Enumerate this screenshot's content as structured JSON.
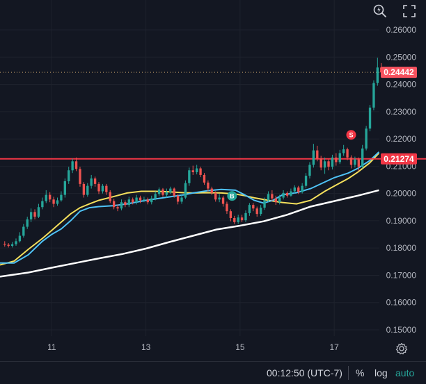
{
  "toolbar": {
    "magnify_icon": "magnify-lightning-icon",
    "fullscreen_icon": "fullscreen-icon"
  },
  "bottom_bar": {
    "time": "00:12:50 (UTC-7)",
    "percent": "%",
    "log": "log",
    "auto": "auto"
  },
  "colors": {
    "background": "#131722",
    "up_candle": "#26a69a",
    "down_candle": "#ef5350",
    "resistance": "#f23645",
    "ma_fast": "#4fc3f7",
    "ma_mid": "#f5e05c",
    "ma_slow": "#ffffff",
    "current_price": "#f7525f"
  },
  "chart_data": {
    "type": "candlestick",
    "y_axis": {
      "ticks": [
        "0.26000",
        "0.25000",
        "0.24000",
        "0.23000",
        "0.22000",
        "0.21000",
        "0.20000",
        "0.19000",
        "0.18000",
        "0.17000",
        "0.16000",
        "0.15000"
      ],
      "range": [
        0.1465,
        0.2635
      ]
    },
    "x_axis": {
      "ticks": [
        {
          "day": 11,
          "label": "11"
        },
        {
          "day": 13,
          "label": "13"
        },
        {
          "day": 15,
          "label": "15"
        },
        {
          "day": 17,
          "label": "17"
        }
      ],
      "range": [
        9.9,
        18.95
      ]
    },
    "resistance_level": {
      "value": 0.2127,
      "label": "0.21274"
    },
    "current_price": {
      "value": 0.24442,
      "label": "0.24442"
    },
    "markers": [
      {
        "label": "B",
        "day": 14.83,
        "price": 0.1991,
        "color": "#26a69a"
      },
      {
        "label": "S",
        "day": 17.36,
        "price": 0.2215,
        "color": "#f23645"
      }
    ],
    "ma_fast": [
      [
        9.9,
        0.1745
      ],
      [
        10.2,
        0.1745
      ],
      [
        10.5,
        0.1775
      ],
      [
        10.8,
        0.1825
      ],
      [
        11.0,
        0.185
      ],
      [
        11.2,
        0.187
      ],
      [
        11.4,
        0.19
      ],
      [
        11.6,
        0.1935
      ],
      [
        11.8,
        0.1948
      ],
      [
        12.0,
        0.1952
      ],
      [
        12.3,
        0.1955
      ],
      [
        12.6,
        0.1962
      ],
      [
        13.0,
        0.1975
      ],
      [
        13.4,
        0.1985
      ],
      [
        13.8,
        0.1995
      ],
      [
        14.0,
        0.2002
      ],
      [
        14.3,
        0.201
      ],
      [
        14.6,
        0.2015
      ],
      [
        14.9,
        0.2012
      ],
      [
        15.1,
        0.1995
      ],
      [
        15.3,
        0.1975
      ],
      [
        15.5,
        0.1965
      ],
      [
        15.7,
        0.1975
      ],
      [
        15.9,
        0.1995
      ],
      [
        16.2,
        0.2003
      ],
      [
        16.5,
        0.2018
      ],
      [
        16.8,
        0.2042
      ],
      [
        17.0,
        0.2058
      ],
      [
        17.3,
        0.2075
      ],
      [
        17.5,
        0.2092
      ],
      [
        17.75,
        0.212
      ],
      [
        17.95,
        0.2152
      ]
    ],
    "ma_mid": [
      [
        9.9,
        0.1738
      ],
      [
        10.2,
        0.1752
      ],
      [
        10.5,
        0.1795
      ],
      [
        10.8,
        0.1835
      ],
      [
        11.0,
        0.1865
      ],
      [
        11.2,
        0.1895
      ],
      [
        11.4,
        0.1925
      ],
      [
        11.6,
        0.1948
      ],
      [
        11.8,
        0.1962
      ],
      [
        12.0,
        0.1975
      ],
      [
        12.3,
        0.1988
      ],
      [
        12.6,
        0.2002
      ],
      [
        12.9,
        0.2008
      ],
      [
        13.2,
        0.2008
      ],
      [
        13.5,
        0.2006
      ],
      [
        13.8,
        0.2003
      ],
      [
        14.0,
        0.2002
      ],
      [
        14.3,
        0.2003
      ],
      [
        14.6,
        0.2002
      ],
      [
        14.9,
        0.1998
      ],
      [
        15.1,
        0.1992
      ],
      [
        15.3,
        0.1984
      ],
      [
        15.6,
        0.1975
      ],
      [
        15.9,
        0.1967
      ],
      [
        16.2,
        0.1962
      ],
      [
        16.5,
        0.1975
      ],
      [
        16.8,
        0.2008
      ],
      [
        17.0,
        0.2027
      ],
      [
        17.3,
        0.2055
      ],
      [
        17.5,
        0.2078
      ],
      [
        17.75,
        0.2112
      ],
      [
        17.95,
        0.2148
      ]
    ],
    "ma_slow": [
      [
        9.9,
        0.1695
      ],
      [
        10.5,
        0.171
      ],
      [
        11.0,
        0.1728
      ],
      [
        11.5,
        0.1745
      ],
      [
        12.0,
        0.1762
      ],
      [
        12.5,
        0.1778
      ],
      [
        13.0,
        0.1798
      ],
      [
        13.5,
        0.1822
      ],
      [
        14.0,
        0.1845
      ],
      [
        14.5,
        0.1868
      ],
      [
        15.0,
        0.1882
      ],
      [
        15.5,
        0.1898
      ],
      [
        16.0,
        0.1922
      ],
      [
        16.5,
        0.1952
      ],
      [
        17.0,
        0.1972
      ],
      [
        17.5,
        0.1992
      ],
      [
        17.95,
        0.2012
      ]
    ],
    "candles": [
      [
        10.0,
        0.1815,
        0.1812,
        0.1825,
        0.1805
      ],
      [
        10.08,
        0.1812,
        0.1808,
        0.1818,
        0.1802
      ],
      [
        10.16,
        0.1808,
        0.1814,
        0.1822,
        0.1802
      ],
      [
        10.24,
        0.1814,
        0.1825,
        0.1835,
        0.1808
      ],
      [
        10.32,
        0.1825,
        0.1845,
        0.1858,
        0.182
      ],
      [
        10.4,
        0.1845,
        0.1878,
        0.1888,
        0.1838
      ],
      [
        10.48,
        0.1878,
        0.1905,
        0.1915,
        0.187
      ],
      [
        10.56,
        0.1905,
        0.1932,
        0.1945,
        0.1895
      ],
      [
        10.64,
        0.1932,
        0.1915,
        0.1942,
        0.1905
      ],
      [
        10.72,
        0.1915,
        0.195,
        0.1962,
        0.191
      ],
      [
        10.8,
        0.195,
        0.1972,
        0.1985,
        0.1942
      ],
      [
        10.88,
        0.1972,
        0.1995,
        0.2012,
        0.1965
      ],
      [
        10.96,
        0.1995,
        0.1978,
        0.2005,
        0.1968
      ],
      [
        11.04,
        0.1978,
        0.1962,
        0.1988,
        0.195
      ],
      [
        11.12,
        0.1962,
        0.1975,
        0.1985,
        0.1955
      ],
      [
        11.2,
        0.1975,
        0.1995,
        0.2008,
        0.197
      ],
      [
        11.28,
        0.1995,
        0.2045,
        0.2055,
        0.1985
      ],
      [
        11.36,
        0.2045,
        0.2085,
        0.2098,
        0.2035
      ],
      [
        11.44,
        0.2085,
        0.2118,
        0.2128,
        0.2075
      ],
      [
        11.52,
        0.2118,
        0.209,
        0.2132,
        0.2082
      ],
      [
        11.6,
        0.209,
        0.2035,
        0.2098,
        0.2025
      ],
      [
        11.68,
        0.2035,
        0.1995,
        0.2042,
        0.1985
      ],
      [
        11.76,
        0.1995,
        0.2028,
        0.2038,
        0.1988
      ],
      [
        11.84,
        0.2028,
        0.2055,
        0.2068,
        0.2018
      ],
      [
        11.92,
        0.2055,
        0.2035,
        0.2062,
        0.2025
      ],
      [
        12.0,
        0.2035,
        0.2008,
        0.2042,
        0.1998
      ],
      [
        12.08,
        0.2008,
        0.2028,
        0.2035,
        0.2
      ],
      [
        12.16,
        0.2028,
        0.2005,
        0.2035,
        0.1995
      ],
      [
        12.24,
        0.2005,
        0.1972,
        0.2012,
        0.1965
      ],
      [
        12.32,
        0.1972,
        0.195,
        0.198,
        0.1942
      ],
      [
        12.4,
        0.195,
        0.1945,
        0.196,
        0.1935
      ],
      [
        12.48,
        0.1945,
        0.1968,
        0.1978,
        0.1938
      ],
      [
        12.56,
        0.1968,
        0.1958,
        0.1975,
        0.195
      ],
      [
        12.64,
        0.1958,
        0.1978,
        0.1988,
        0.195
      ],
      [
        12.72,
        0.1978,
        0.1968,
        0.1985,
        0.196
      ],
      [
        12.8,
        0.1968,
        0.1985,
        0.1995,
        0.196
      ],
      [
        12.88,
        0.1985,
        0.1975,
        0.1992,
        0.1965
      ],
      [
        12.96,
        0.1975,
        0.1978,
        0.1988,
        0.1968
      ],
      [
        13.04,
        0.1978,
        0.1968,
        0.1985,
        0.196
      ],
      [
        13.12,
        0.1968,
        0.1982,
        0.1992,
        0.196
      ],
      [
        13.2,
        0.1982,
        0.1998,
        0.2008,
        0.1975
      ],
      [
        13.28,
        0.1998,
        0.2015,
        0.2022,
        0.199
      ],
      [
        13.36,
        0.2015,
        0.1995,
        0.202,
        0.1988
      ],
      [
        13.44,
        0.1995,
        0.2005,
        0.2018,
        0.1985
      ],
      [
        13.52,
        0.2005,
        0.2018,
        0.2025,
        0.1998
      ],
      [
        13.6,
        0.2018,
        0.1992,
        0.2022,
        0.1985
      ],
      [
        13.68,
        0.1992,
        0.197,
        0.1998,
        0.196
      ],
      [
        13.76,
        0.197,
        0.1985,
        0.1995,
        0.1962
      ],
      [
        13.84,
        0.1985,
        0.2038,
        0.2048,
        0.198
      ],
      [
        13.92,
        0.2038,
        0.2085,
        0.2095,
        0.2028
      ],
      [
        14.0,
        0.2085,
        0.2078,
        0.2102,
        0.2068
      ],
      [
        14.08,
        0.2078,
        0.2092,
        0.2105,
        0.207
      ],
      [
        14.16,
        0.2092,
        0.2068,
        0.2098,
        0.206
      ],
      [
        14.24,
        0.2068,
        0.204,
        0.2075,
        0.2032
      ],
      [
        14.32,
        0.204,
        0.2018,
        0.2048,
        0.2008
      ],
      [
        14.4,
        0.2018,
        0.2002,
        0.2025,
        0.1995
      ],
      [
        14.48,
        0.2002,
        0.1978,
        0.2008,
        0.197
      ],
      [
        14.56,
        0.1978,
        0.1985,
        0.1998,
        0.1968
      ],
      [
        14.64,
        0.1985,
        0.1962,
        0.1992,
        0.1952
      ],
      [
        14.72,
        0.1962,
        0.1935,
        0.197,
        0.1925
      ],
      [
        14.8,
        0.1935,
        0.191,
        0.1942,
        0.1898
      ],
      [
        14.88,
        0.191,
        0.1895,
        0.1918,
        0.1888
      ],
      [
        14.96,
        0.1895,
        0.1912,
        0.1922,
        0.1888
      ],
      [
        15.04,
        0.1912,
        0.1902,
        0.1922,
        0.1895
      ],
      [
        15.12,
        0.1902,
        0.1928,
        0.1938,
        0.1895
      ],
      [
        15.2,
        0.1928,
        0.1958,
        0.1965,
        0.1918
      ],
      [
        15.28,
        0.1958,
        0.1945,
        0.1965,
        0.1935
      ],
      [
        15.36,
        0.1945,
        0.1925,
        0.1952,
        0.1915
      ],
      [
        15.44,
        0.1925,
        0.1948,
        0.1958,
        0.1918
      ],
      [
        15.52,
        0.1948,
        0.1975,
        0.1985,
        0.194
      ],
      [
        15.6,
        0.1975,
        0.1998,
        0.2008,
        0.1968
      ],
      [
        15.68,
        0.1998,
        0.1982,
        0.2012,
        0.1972
      ],
      [
        15.76,
        0.1982,
        0.1968,
        0.1992,
        0.1958
      ],
      [
        15.84,
        0.1968,
        0.1985,
        0.1995,
        0.196
      ],
      [
        15.92,
        0.1985,
        0.2002,
        0.2012,
        0.1978
      ],
      [
        16.0,
        0.2002,
        0.1992,
        0.2008,
        0.1985
      ],
      [
        16.08,
        0.1992,
        0.2008,
        0.2018,
        0.1988
      ],
      [
        16.16,
        0.2008,
        0.2022,
        0.203,
        0.2
      ],
      [
        16.24,
        0.2022,
        0.2005,
        0.2028,
        0.1998
      ],
      [
        16.32,
        0.2005,
        0.2028,
        0.2038,
        0.2
      ],
      [
        16.4,
        0.2028,
        0.2065,
        0.2075,
        0.202
      ],
      [
        16.48,
        0.2065,
        0.2105,
        0.2115,
        0.2055
      ],
      [
        16.56,
        0.2105,
        0.2158,
        0.2182,
        0.2095
      ],
      [
        16.64,
        0.2158,
        0.2128,
        0.2175,
        0.2118
      ],
      [
        16.72,
        0.2128,
        0.2095,
        0.2138,
        0.2085
      ],
      [
        16.8,
        0.2095,
        0.2118,
        0.2132,
        0.2072
      ],
      [
        16.88,
        0.2118,
        0.2098,
        0.2125,
        0.2085
      ],
      [
        16.96,
        0.2098,
        0.2132,
        0.2142,
        0.2088
      ],
      [
        17.04,
        0.2132,
        0.2115,
        0.2148,
        0.2102
      ],
      [
        17.12,
        0.2115,
        0.2148,
        0.216,
        0.2108
      ],
      [
        17.2,
        0.2148,
        0.2162,
        0.2178,
        0.2138
      ],
      [
        17.28,
        0.2162,
        0.2132,
        0.2168,
        0.2122
      ],
      [
        17.36,
        0.2132,
        0.2105,
        0.214,
        0.2092
      ],
      [
        17.44,
        0.2105,
        0.2125,
        0.2135,
        0.2095
      ],
      [
        17.52,
        0.2125,
        0.2098,
        0.2132,
        0.2082
      ],
      [
        17.6,
        0.2098,
        0.2165,
        0.2178,
        0.2092
      ],
      [
        17.68,
        0.2165,
        0.2238,
        0.2248,
        0.2158
      ],
      [
        17.76,
        0.2238,
        0.2315,
        0.2325,
        0.2228
      ],
      [
        17.84,
        0.2315,
        0.2405,
        0.2415,
        0.2305
      ],
      [
        17.92,
        0.2405,
        0.2462,
        0.2498,
        0.2395
      ],
      [
        18.0,
        0.2462,
        0.2444,
        0.2478,
        0.2432
      ]
    ]
  }
}
